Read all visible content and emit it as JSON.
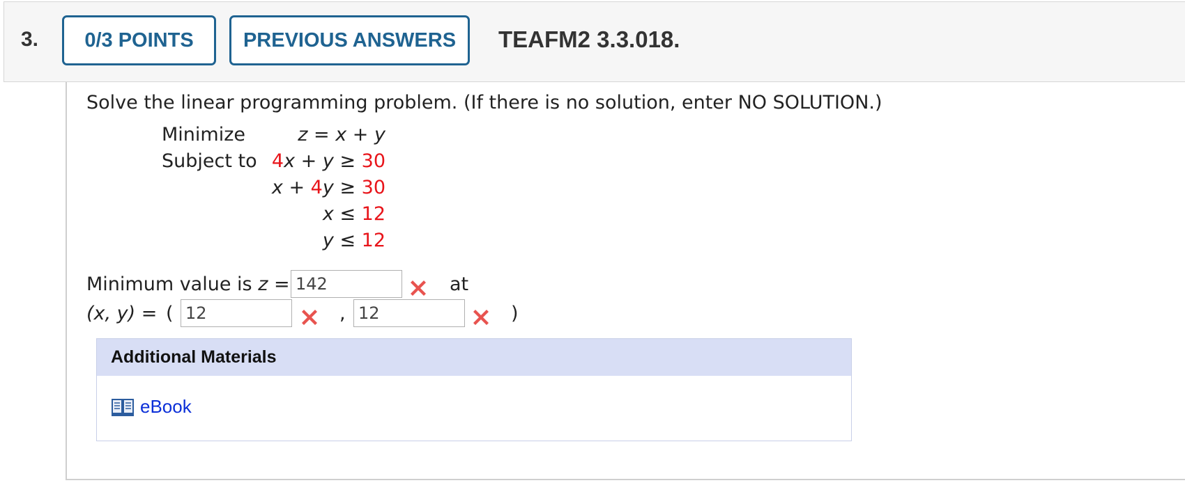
{
  "question": {
    "number": "3.",
    "points_label": "0/3 POINTS",
    "previous_answers_label": "PREVIOUS ANSWERS",
    "id": "TEAFM2 3.3.018."
  },
  "problem": {
    "prompt": "Solve the linear programming problem. (If there is no solution, enter NO SOLUTION.)",
    "minimize_label": "Minimize",
    "subject_to_label": "Subject to",
    "objective": "z = x + y",
    "constraints": [
      {
        "coef_x": "4",
        "rest": "x + y ≥ ",
        "rhs": "30"
      },
      {
        "coef_y": "4",
        "pre": "x + ",
        "post": "y ≥ ",
        "rhs": "30"
      },
      {
        "lhs": "x ≤ ",
        "rhs": "12"
      },
      {
        "lhs": "y ≤ ",
        "rhs": "12"
      }
    ]
  },
  "answer": {
    "min_value_label": "Minimum value is",
    "z_eq": "z =",
    "z_value": "142",
    "at_label": "at",
    "point_label": "(x, y) =",
    "open_paren": "(",
    "comma": ",",
    "close_paren": ")",
    "x_value": "12",
    "y_value": "12"
  },
  "materials": {
    "heading": "Additional Materials",
    "ebook_label": "eBook"
  },
  "colors": {
    "accent": "#1f6391",
    "highlight_red": "#e8141a",
    "link": "#0b2fd8",
    "materials_header_bg": "#d8def5"
  }
}
